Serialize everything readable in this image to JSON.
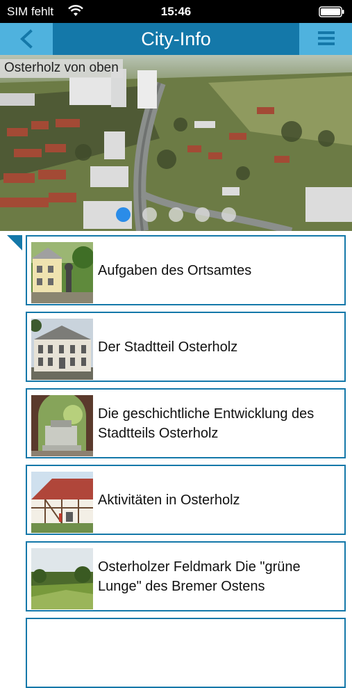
{
  "status_bar": {
    "carrier": "SIM fehlt",
    "time": "15:46",
    "wifi_icon": "wifi-icon",
    "battery_icon": "battery-icon"
  },
  "nav": {
    "title": "City-Info",
    "back_icon": "chevron-left-icon",
    "menu_icon": "hamburger-menu-icon",
    "bar_color": "#1478a9",
    "button_color": "#4fb2de"
  },
  "hero": {
    "caption": "Osterholz von oben",
    "slide_count": 5,
    "active_slide": 1
  },
  "list": {
    "items": [
      {
        "label": "Aufgaben des Ortsamtes"
      },
      {
        "label": "Der Stadtteil Osterholz"
      },
      {
        "label": "Die geschichtliche Entwicklung des Stadtteils Osterholz"
      },
      {
        "label": "Aktivitäten in Osterholz"
      },
      {
        "label": "Osterholzer Feldmark Die \"grüne Lunge\" des Bremer Ostens"
      }
    ]
  }
}
